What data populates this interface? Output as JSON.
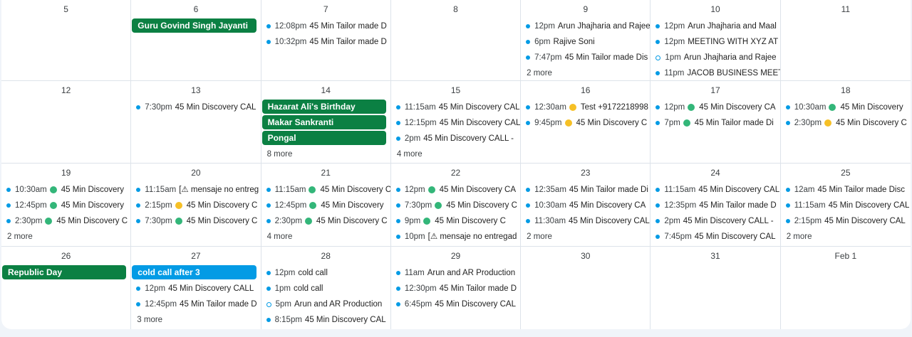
{
  "colors": {
    "calendar_blue": "#039be5",
    "all_day_green": "#0b8043",
    "badge_green": "#33b679",
    "badge_yellow": "#f6c026"
  },
  "weeks": [
    [
      {
        "day": "5",
        "allday": [],
        "events": [],
        "more": ""
      },
      {
        "day": "6",
        "allday": [
          {
            "title": "Guru Govind Singh Jayanti",
            "color": "green"
          }
        ],
        "events": [],
        "more": ""
      },
      {
        "day": "7",
        "allday": [],
        "events": [
          {
            "time": "12:08pm",
            "title": "45 Min Tailor made D"
          },
          {
            "time": "10:32pm",
            "title": "45 Min Tailor made D"
          }
        ],
        "more": ""
      },
      {
        "day": "8",
        "allday": [],
        "events": [],
        "more": ""
      },
      {
        "day": "9",
        "allday": [],
        "events": [
          {
            "time": "12pm",
            "title": "Arun Jhajharia and Rajee"
          },
          {
            "time": "6pm",
            "title": "Rajive Soni"
          },
          {
            "time": "7:47pm",
            "title": "45 Min Tailor made Dis"
          }
        ],
        "more": "2 more"
      },
      {
        "day": "10",
        "allday": [],
        "events": [
          {
            "time": "12pm",
            "title": "Arun Jhajharia and Maal"
          },
          {
            "time": "12pm",
            "title": "MEETING WITH XYZ AT 1"
          },
          {
            "time": "1pm",
            "title": "Arun Jhajharia and Rajee",
            "hollow": true
          },
          {
            "time": "11pm",
            "title": "JACOB BUSINESS MEET"
          }
        ],
        "more": ""
      },
      {
        "day": "11",
        "allday": [],
        "events": [],
        "more": ""
      }
    ],
    [
      {
        "day": "12",
        "allday": [],
        "events": [],
        "more": ""
      },
      {
        "day": "13",
        "allday": [],
        "events": [
          {
            "time": "7:30pm",
            "title": "45 Min Discovery CAL"
          }
        ],
        "more": ""
      },
      {
        "day": "14",
        "allday": [
          {
            "title": "Hazarat Ali's Birthday",
            "color": "green"
          },
          {
            "title": "Makar Sankranti",
            "color": "green"
          },
          {
            "title": "Pongal",
            "color": "green"
          }
        ],
        "events": [],
        "more": "8 more"
      },
      {
        "day": "15",
        "allday": [],
        "events": [
          {
            "time": "11:15am",
            "title": "45 Min Discovery CAL"
          },
          {
            "time": "12:15pm",
            "title": "45 Min Discovery CAL"
          },
          {
            "time": "2pm",
            "title": "45 Min Discovery CALL -"
          }
        ],
        "more": "4 more"
      },
      {
        "day": "16",
        "allday": [],
        "events": [
          {
            "time": "12:30am",
            "title": "Test +9172218998",
            "badge": "yellow"
          },
          {
            "time": "9:45pm",
            "title": "45 Min Discovery C",
            "badge": "yellow"
          }
        ],
        "more": ""
      },
      {
        "day": "17",
        "allday": [],
        "events": [
          {
            "time": "12pm",
            "title": "45 Min Discovery CA",
            "badge": "green"
          },
          {
            "time": "7pm",
            "title": "45 Min Tailor made Di",
            "badge": "green"
          }
        ],
        "more": ""
      },
      {
        "day": "18",
        "allday": [],
        "events": [
          {
            "time": "10:30am",
            "title": "45 Min Discovery",
            "badge": "green"
          },
          {
            "time": "2:30pm",
            "title": "45 Min Discovery C",
            "badge": "yellow"
          }
        ],
        "more": ""
      }
    ],
    [
      {
        "day": "19",
        "allday": [],
        "events": [
          {
            "time": "10:30am",
            "title": "45 Min Discovery",
            "badge": "green"
          },
          {
            "time": "12:45pm",
            "title": "45 Min Discovery",
            "badge": "green"
          },
          {
            "time": "2:30pm",
            "title": "45 Min Discovery C",
            "badge": "green"
          }
        ],
        "more": "2 more"
      },
      {
        "day": "20",
        "allday": [],
        "events": [
          {
            "time": "11:15am",
            "title": "[⚠ mensaje no entreg"
          },
          {
            "time": "2:15pm",
            "title": "45 Min Discovery C",
            "badge": "yellow"
          },
          {
            "time": "7:30pm",
            "title": "45 Min Discovery C",
            "badge": "green"
          }
        ],
        "more": ""
      },
      {
        "day": "21",
        "allday": [],
        "events": [
          {
            "time": "11:15am",
            "title": "45 Min Discovery C",
            "badge": "green"
          },
          {
            "time": "12:45pm",
            "title": "45 Min Discovery",
            "badge": "green"
          },
          {
            "time": "2:30pm",
            "title": "45 Min Discovery C",
            "badge": "green"
          }
        ],
        "more": "4 more"
      },
      {
        "day": "22",
        "allday": [],
        "events": [
          {
            "time": "12pm",
            "title": "45 Min Discovery CA",
            "badge": "green"
          },
          {
            "time": "7:30pm",
            "title": "45 Min Discovery C",
            "badge": "green"
          },
          {
            "time": "9pm",
            "title": "45 Min Discovery C",
            "badge": "green"
          },
          {
            "time": "10pm",
            "title": "[⚠ mensaje no entregad"
          }
        ],
        "more": ""
      },
      {
        "day": "23",
        "allday": [],
        "events": [
          {
            "time": "12:35am",
            "title": "45 Min Tailor made Di"
          },
          {
            "time": "10:30am",
            "title": "45 Min Discovery CA"
          },
          {
            "time": "11:30am",
            "title": "45 Min Discovery CAL"
          }
        ],
        "more": "2 more"
      },
      {
        "day": "24",
        "allday": [],
        "events": [
          {
            "time": "11:15am",
            "title": "45 Min Discovery CAL"
          },
          {
            "time": "12:35pm",
            "title": "45 Min Tailor made D"
          },
          {
            "time": "2pm",
            "title": "45 Min Discovery CALL -"
          },
          {
            "time": "7:45pm",
            "title": "45 Min Discovery CAL"
          }
        ],
        "more": ""
      },
      {
        "day": "25",
        "allday": [],
        "events": [
          {
            "time": "12am",
            "title": "45 Min Tailor made Disc"
          },
          {
            "time": "11:15am",
            "title": "45 Min Discovery CAL"
          },
          {
            "time": "2:15pm",
            "title": "45 Min Discovery CAL"
          }
        ],
        "more": "2 more"
      }
    ],
    [
      {
        "day": "26",
        "allday": [
          {
            "title": "Republic Day",
            "color": "green"
          }
        ],
        "events": [],
        "more": ""
      },
      {
        "day": "27",
        "allday": [
          {
            "title": "cold call after 3",
            "color": "blue"
          }
        ],
        "events": [
          {
            "time": "12pm",
            "title": "45 Min Discovery CALL"
          },
          {
            "time": "12:45pm",
            "title": "45 Min Tailor made D"
          }
        ],
        "more": "3 more"
      },
      {
        "day": "28",
        "allday": [],
        "events": [
          {
            "time": "12pm",
            "title": "cold call"
          },
          {
            "time": "1pm",
            "title": "cold call"
          },
          {
            "time": "5pm",
            "title": "Arun and AR Production",
            "hollow": true
          },
          {
            "time": "8:15pm",
            "title": "45 Min Discovery CAL"
          }
        ],
        "more": ""
      },
      {
        "day": "29",
        "allday": [],
        "events": [
          {
            "time": "11am",
            "title": "Arun and AR Production"
          },
          {
            "time": "12:30pm",
            "title": "45 Min Tailor made D"
          },
          {
            "time": "6:45pm",
            "title": "45 Min Discovery CAL"
          }
        ],
        "more": ""
      },
      {
        "day": "30",
        "allday": [],
        "events": [],
        "more": ""
      },
      {
        "day": "31",
        "allday": [],
        "events": [],
        "more": ""
      },
      {
        "day": "Feb 1",
        "allday": [],
        "events": [],
        "more": ""
      }
    ]
  ]
}
